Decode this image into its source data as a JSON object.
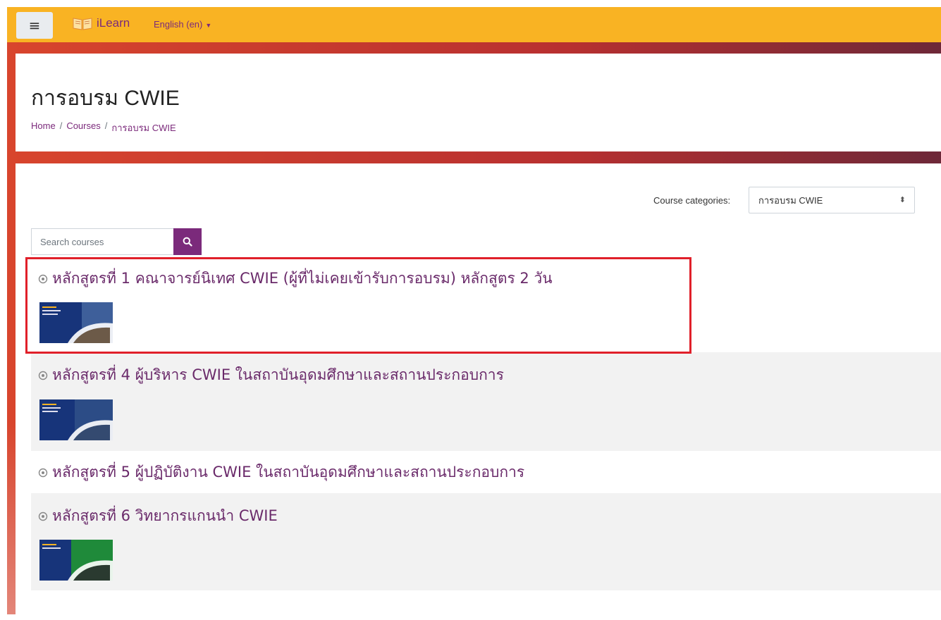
{
  "navbar": {
    "menu_icon": "hamburger-icon",
    "brand": "iLearn",
    "language": "English (en)"
  },
  "header": {
    "title": "การอบรม CWIE",
    "breadcrumb": [
      "Home",
      "Courses",
      "การอบรม CWIE"
    ]
  },
  "filters": {
    "category_label": "Course categories:",
    "category_value": "การอบรม CWIE",
    "search_placeholder": "Search courses"
  },
  "courses": [
    {
      "title": "หลักสูตรที่ 1 คณาจารย์นิเทศ CWIE (ผู้ที่ไม่เคยเข้ารับการอบรม) หลักสูตร 2 วัน",
      "has_image": true
    },
    {
      "title": "หลักสูตรที่ 4 ผู้บริหาร CWIE ในสถาบันอุดมศึกษาและสถานประกอบการ",
      "has_image": true
    },
    {
      "title": "หลักสูตรที่ 5 ผู้ปฏิบัติงาน CWIE ในสถาบันอุดมศึกษาและสถานประกอบการ",
      "has_image": false
    },
    {
      "title": "หลักสูตรที่ 6 วิทยากรแกนนำ CWIE",
      "has_image": true
    }
  ],
  "colors": {
    "navbar": "#f9b323",
    "accent": "#7b2a7b",
    "highlight": "#e0202a"
  }
}
